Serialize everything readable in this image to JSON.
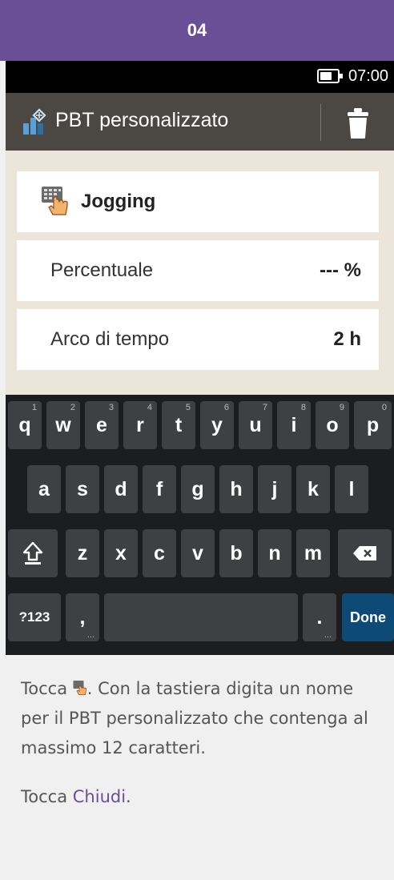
{
  "step": {
    "number": "04"
  },
  "statusbar": {
    "time": "07:00",
    "battery_icon": "battery-icon"
  },
  "titlebar": {
    "icon": "custom-pbt-icon",
    "title": "PBT personalizzato",
    "delete_icon": "trash-icon"
  },
  "form": {
    "name_row": {
      "icon": "keyboard-hand-icon",
      "value": "Jogging"
    },
    "percent_row": {
      "label": "Percentuale",
      "value": "--- %"
    },
    "time_row": {
      "label": "Arco di tempo",
      "value": "2 h"
    }
  },
  "keyboard": {
    "row1": [
      "q",
      "w",
      "e",
      "r",
      "t",
      "y",
      "u",
      "i",
      "o",
      "p"
    ],
    "row1_hints": [
      "1",
      "2",
      "3",
      "4",
      "5",
      "6",
      "7",
      "8",
      "9",
      "0"
    ],
    "row2": [
      "a",
      "s",
      "d",
      "f",
      "g",
      "h",
      "j",
      "k",
      "l"
    ],
    "row3": [
      "z",
      "x",
      "c",
      "v",
      "b",
      "n",
      "m"
    ],
    "shift_icon": "shift-icon",
    "backspace_icon": "backspace-icon",
    "symbols_label": "?123",
    "comma_label": ",",
    "period_label": ".",
    "done_label": "Done",
    "more_hint": "..."
  },
  "instructions": {
    "p1_before": "Tocca",
    "p1_after": ". Con la tastiera digita un nome per il PBT personalizzato che contenga al massimo 12 caratteri.",
    "p2_before": "Tocca",
    "p2_link": "Chiudi",
    "p2_after": "."
  },
  "colors": {
    "accent": "#6a4f97",
    "titlebar": "#4b4742",
    "content_bg": "#ece6da",
    "done_key": "#0d4a75"
  }
}
